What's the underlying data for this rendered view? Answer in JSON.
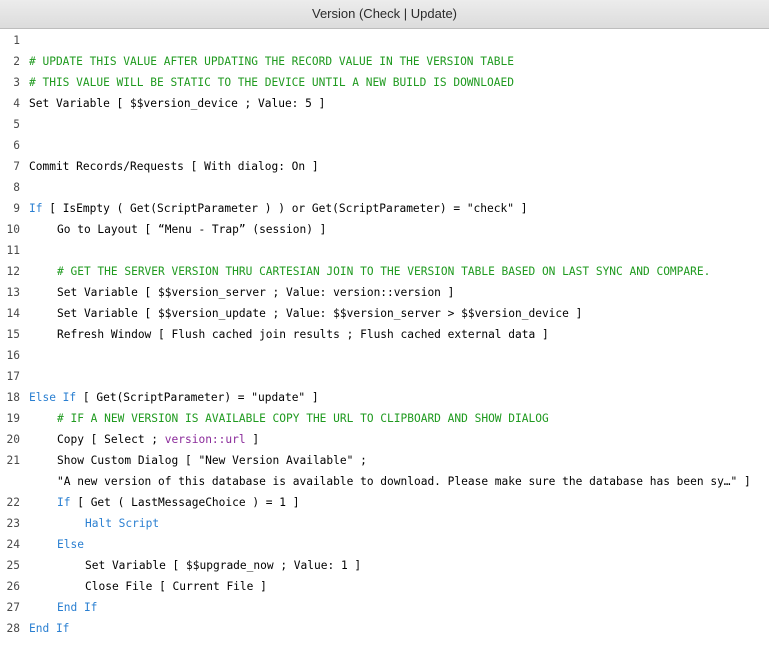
{
  "window": {
    "title": "Version (Check | Update)"
  },
  "script": {
    "lines": [
      {
        "n": "1",
        "parts": []
      },
      {
        "n": "2",
        "parts": [
          {
            "t": "# UPDATE THIS VALUE AFTER UPDATING THE RECORD VALUE IN THE VERSION TABLE",
            "c": "comment"
          }
        ]
      },
      {
        "n": "3",
        "parts": [
          {
            "t": "# THIS VALUE WILL BE STATIC TO THE DEVICE UNTIL A NEW BUILD IS DOWNLOAED",
            "c": "comment"
          }
        ]
      },
      {
        "n": "4",
        "parts": [
          {
            "t": "Set Variable [ $$version_device ; Value: 5 ]",
            "c": ""
          }
        ]
      },
      {
        "n": "5",
        "parts": []
      },
      {
        "n": "6",
        "parts": []
      },
      {
        "n": "7",
        "parts": [
          {
            "t": "Commit Records/Requests [ With dialog: On ]",
            "c": ""
          }
        ]
      },
      {
        "n": "8",
        "parts": []
      },
      {
        "n": "9",
        "parts": [
          {
            "t": "If",
            "c": "kw"
          },
          {
            "t": " [ IsEmpty ( Get(ScriptParameter ) ) or Get(ScriptParameter) = \"check\" ]",
            "c": ""
          }
        ]
      },
      {
        "n": "10",
        "indent": 1,
        "parts": [
          {
            "t": "Go to Layout [ “Menu - Trap” (session) ]",
            "c": ""
          }
        ]
      },
      {
        "n": "11",
        "parts": []
      },
      {
        "n": "12",
        "indent": 1,
        "parts": [
          {
            "t": "# GET THE SERVER VERSION THRU CARTESIAN JOIN TO THE VERSION TABLE BASED ON LAST SYNC AND COMPARE.",
            "c": "comment"
          }
        ]
      },
      {
        "n": "13",
        "indent": 1,
        "parts": [
          {
            "t": "Set Variable [ $$version_server ; Value: version::version ]",
            "c": ""
          }
        ]
      },
      {
        "n": "14",
        "indent": 1,
        "parts": [
          {
            "t": "Set Variable [ $$version_update ; Value: $$version_server > $$version_device ]",
            "c": ""
          }
        ]
      },
      {
        "n": "15",
        "indent": 1,
        "parts": [
          {
            "t": "Refresh Window [ Flush cached join results ; Flush cached external data ]",
            "c": ""
          }
        ]
      },
      {
        "n": "16",
        "parts": []
      },
      {
        "n": "17",
        "parts": []
      },
      {
        "n": "18",
        "parts": [
          {
            "t": "Else If",
            "c": "kw"
          },
          {
            "t": " [ Get(ScriptParameter) = \"update\" ]",
            "c": ""
          }
        ]
      },
      {
        "n": "19",
        "indent": 1,
        "parts": [
          {
            "t": "# IF A NEW VERSION IS AVAILABLE COPY THE URL TO CLIPBOARD AND SHOW DIALOG",
            "c": "comment"
          }
        ]
      },
      {
        "n": "20",
        "indent": 1,
        "parts": [
          {
            "t": "Copy [ Select ; ",
            "c": ""
          },
          {
            "t": "version::url",
            "c": "field"
          },
          {
            "t": " ]",
            "c": ""
          }
        ]
      },
      {
        "n": "21",
        "indent": 1,
        "parts": [
          {
            "t": "Show Custom Dialog [ \"New Version Available\" ;",
            "c": ""
          }
        ]
      },
      {
        "n": "",
        "indent": 1,
        "parts": [
          {
            "t": "\"A new version of this database is available to download. Please make sure the database has been sy…\" ]",
            "c": ""
          }
        ]
      },
      {
        "n": "22",
        "indent": 1,
        "parts": [
          {
            "t": "If",
            "c": "kw"
          },
          {
            "t": " [ Get ( LastMessageChoice ) = 1 ]",
            "c": ""
          }
        ]
      },
      {
        "n": "23",
        "indent": 2,
        "parts": [
          {
            "t": "Halt Script",
            "c": "kw"
          }
        ]
      },
      {
        "n": "24",
        "indent": 1,
        "parts": [
          {
            "t": "Else",
            "c": "kw"
          }
        ]
      },
      {
        "n": "25",
        "indent": 2,
        "parts": [
          {
            "t": "Set Variable [ $$upgrade_now ; Value: 1 ]",
            "c": ""
          }
        ]
      },
      {
        "n": "26",
        "indent": 2,
        "parts": [
          {
            "t": "Close File [ Current File ]",
            "c": ""
          }
        ]
      },
      {
        "n": "27",
        "indent": 1,
        "parts": [
          {
            "t": "End If",
            "c": "kw"
          }
        ]
      },
      {
        "n": "28",
        "parts": [
          {
            "t": "End If",
            "c": "kw"
          }
        ]
      }
    ]
  }
}
